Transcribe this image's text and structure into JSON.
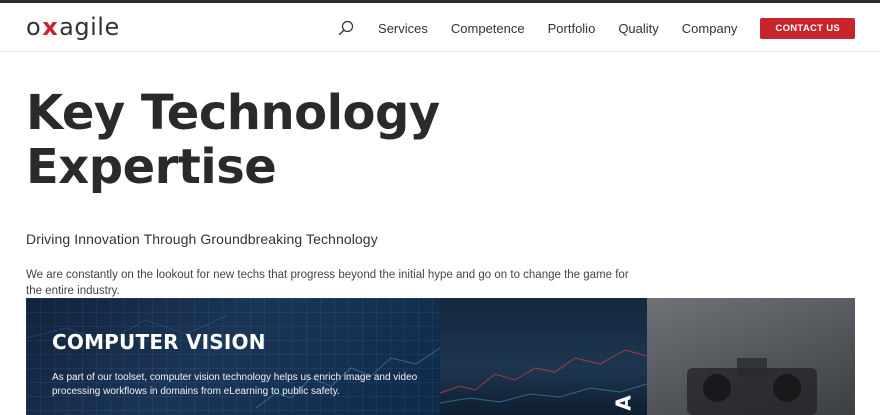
{
  "header": {
    "logo_prefix": "o",
    "logo_x": "x",
    "logo_suffix": "agile",
    "search_icon": "search-icon",
    "nav": [
      "Services",
      "Competence",
      "Portfolio",
      "Quality",
      "Company"
    ],
    "contact_label": "CONTACT US",
    "accent_color": "#c8242b"
  },
  "hero": {
    "title_line1": "Key Technology",
    "title_line2": "Expertise",
    "subtitle": "Driving Innovation Through Groundbreaking Technology",
    "description": "We are constantly on the lookout for new techs that progress beyond the initial hype and go on to change the game for the entire industry."
  },
  "cards": {
    "cv_title": "COMPUTER VISION",
    "cv_desc": "As part of our toolset, computer vision technology helps us enrich image and video processing workflows in domains from eLearning to public safety.",
    "mid_vertical": "A"
  }
}
